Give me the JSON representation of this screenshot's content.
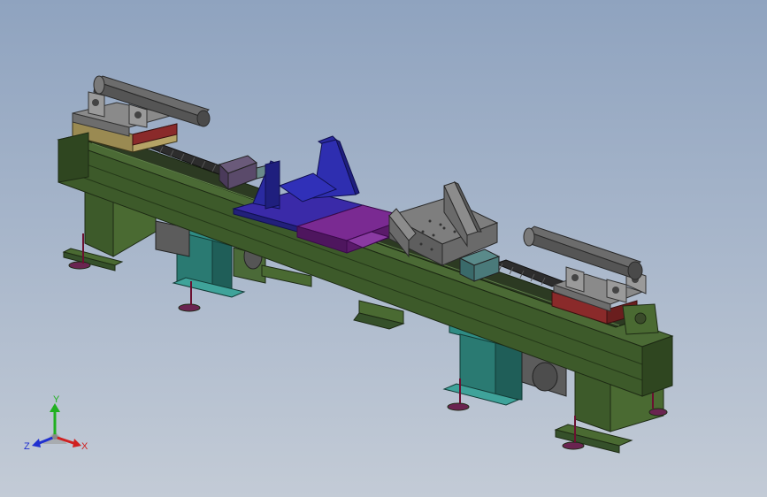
{
  "viewport": {
    "background_top": "#8fa3bf",
    "background_bottom": "#c3cbd6"
  },
  "model": {
    "frame_color": "#3f5a2c",
    "frame_edge_color": "#1d2a14",
    "leg_brace_color": "#2f8c84",
    "carriage_blue": "#2a2aa0",
    "carriage_purple": "#6e1d86",
    "cylinder_color": "#6c6c6c",
    "plate_color": "#8a8a8a",
    "red_block_color": "#8a2a2a"
  },
  "triad": {
    "x_label": "X",
    "y_label": "Y",
    "z_label": "Z",
    "x_color": "#d02020",
    "y_color": "#20b020",
    "z_color": "#2030d0"
  }
}
